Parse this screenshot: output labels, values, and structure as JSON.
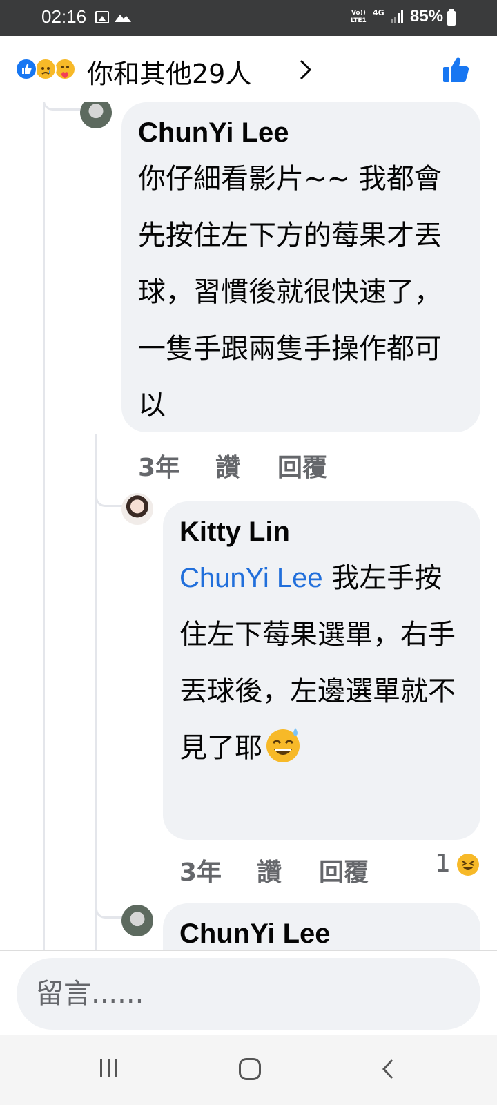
{
  "status_bar": {
    "time": "02:16",
    "network_volte": "Vo))\nLTE1",
    "network_type": "4G",
    "battery": "85%"
  },
  "header": {
    "reaction_icons": [
      "like-icon",
      "sad-icon",
      "care-icon"
    ],
    "label": "你和其他29人",
    "chevron": "›"
  },
  "comments": [
    {
      "name": "ChunYi Lee",
      "text": "你仔細看影片~~ 我都會先按住左下方的莓果才丟球，習慣後就很快速了，一隻手跟兩隻手操作都可以",
      "time": "3年",
      "like": "讚",
      "reply": "回覆"
    },
    {
      "name": "Kitty Lin",
      "mention": "ChunYi Lee",
      "text": "我左手按住左下莓果選單，右手丟球後，左邊選單就不見了耶",
      "time": "3年",
      "like": "讚",
      "reply": "回覆",
      "reaction_count": "1"
    },
    {
      "name": "ChunYi Lee"
    }
  ],
  "composer": {
    "placeholder": "留言......"
  },
  "colors": {
    "like_blue": "#1877f2",
    "mention_blue": "#216fdb",
    "bubble_bg": "#f0f2f5",
    "status_bar_bg": "#3a3b3c"
  }
}
